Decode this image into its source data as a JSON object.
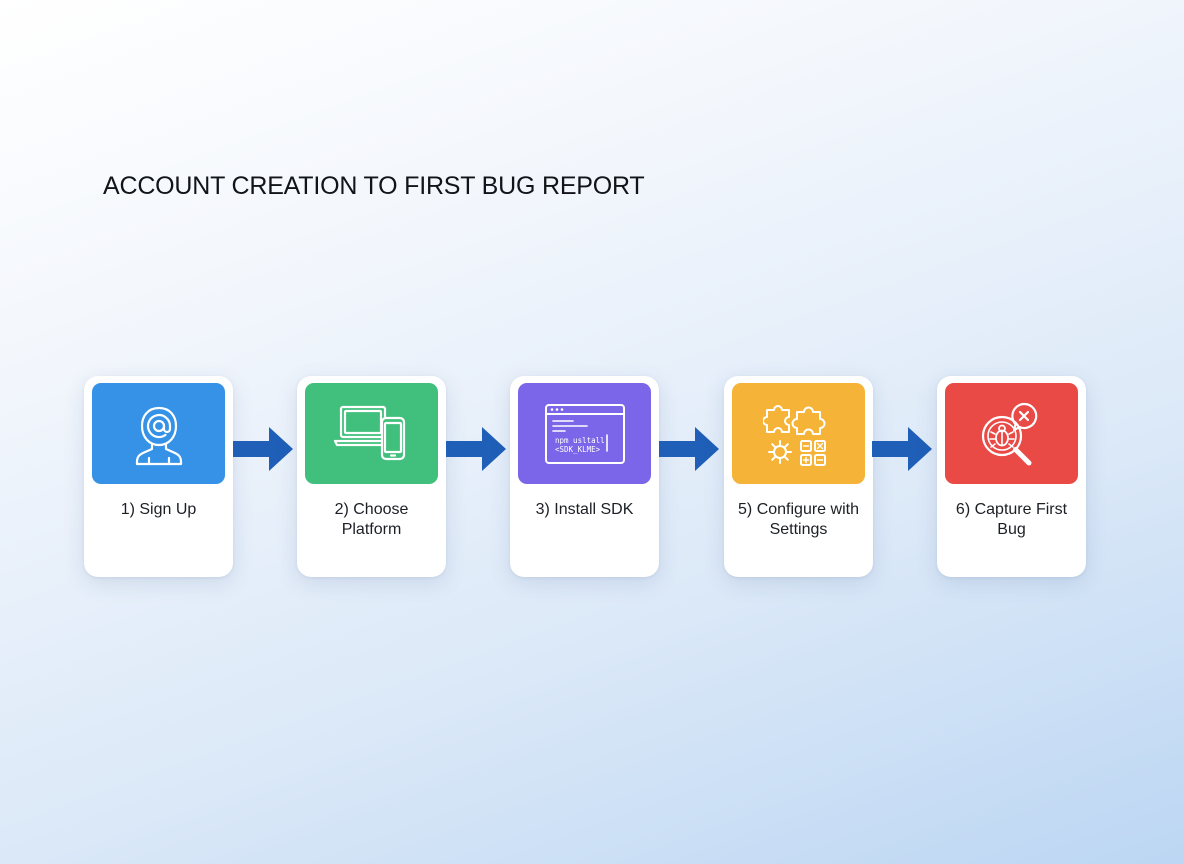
{
  "title": "ACCOUNT CREATION TO FIRST BUG REPORT",
  "colors": {
    "arrow": "#1f5fb8",
    "icon_stroke": "#ffffff"
  },
  "steps": [
    {
      "label": "1) Sign Up",
      "color": "#3592e6",
      "icon": "user-at-icon"
    },
    {
      "label": "2) Choose Platform",
      "color": "#41bf7c",
      "icon": "laptop-phone-icon"
    },
    {
      "label": "3) Install SDK",
      "color": "#7b66ea",
      "icon": "code-window-icon",
      "code_lines": [
        "npm usltall",
        "<SDK_KLME>"
      ]
    },
    {
      "label": "5) Configure with Settings",
      "color": "#f5b437",
      "icon": "puzzle-gear-icon"
    },
    {
      "label": "6) Capture First Bug",
      "color": "#e94a46",
      "icon": "bug-search-icon"
    }
  ]
}
